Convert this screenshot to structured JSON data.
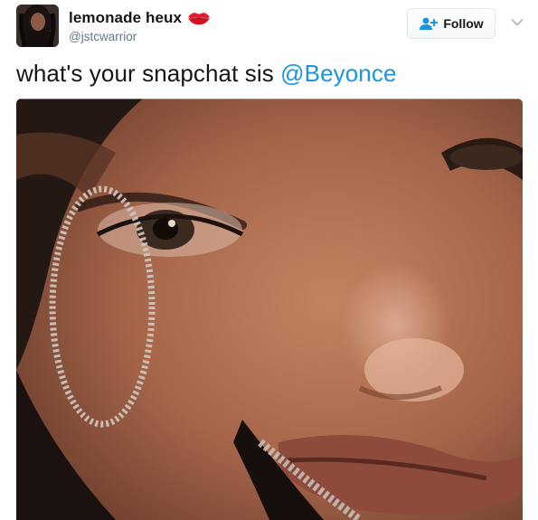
{
  "tweet": {
    "user": {
      "display_name": "lemonade heux",
      "handle": "@jstcwarrior",
      "badge_icon": "lips-emoji-icon"
    },
    "follow_button": {
      "label": "Follow",
      "icon": "add-user-icon"
    },
    "menu_icon": "chevron-down-icon",
    "text": {
      "body": "what's your snapchat sis ",
      "mention": "@Beyonce"
    },
    "media": {
      "type": "video-thumbnail"
    }
  },
  "colors": {
    "text": "#14171a",
    "secondary_text": "#657786",
    "link": "#1b95e0",
    "border": "#e1e8ed"
  }
}
